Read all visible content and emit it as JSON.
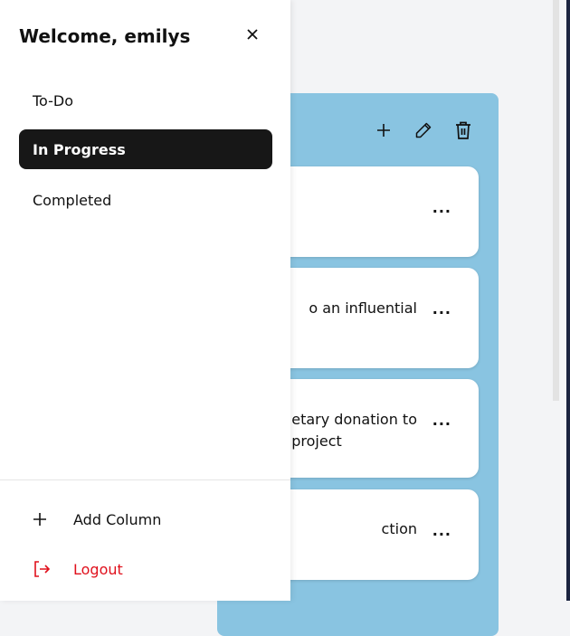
{
  "drawer": {
    "title": "Welcome, emilys",
    "nav": [
      {
        "label": "To-Do",
        "active": false
      },
      {
        "label": "In Progress",
        "active": true
      },
      {
        "label": "Completed",
        "active": false
      }
    ],
    "add_column": "Add Column",
    "logout": "Logout"
  },
  "column": {
    "cards": [
      {
        "text": ""
      },
      {
        "text": "o an influential"
      },
      {
        "text": "etary donation to\nproject"
      },
      {
        "text": "ction"
      }
    ],
    "more_label": "..."
  },
  "colors": {
    "column_bg": "#89c4e1",
    "logout": "#e0101c",
    "active": "#171717"
  }
}
